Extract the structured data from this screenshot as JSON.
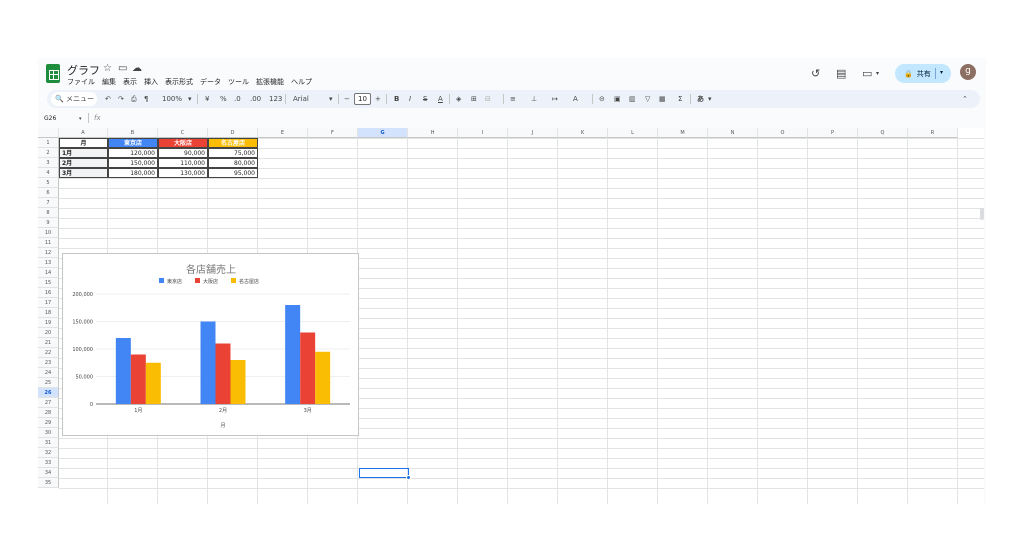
{
  "document": {
    "title": "グラフ"
  },
  "menu": [
    "ファイル",
    "編集",
    "表示",
    "挿入",
    "表示形式",
    "データ",
    "ツール",
    "拡張機能",
    "ヘルプ"
  ],
  "share": {
    "label": "共有"
  },
  "avatar": {
    "initial": "g"
  },
  "toolbar": {
    "search_label": "メニュー",
    "zoom": "100%",
    "currency": "¥",
    "percent": "%",
    "dec_decrease": ".0",
    "dec_increase": ".00",
    "format_123": "123",
    "font": "Arial",
    "font_size": "10",
    "bold": "B",
    "italic": "I",
    "strike": "S",
    "text_color": "A",
    "sum": "Σ",
    "input_tools": "あ"
  },
  "formula_bar": {
    "name_box": "G26",
    "fx": "fx"
  },
  "grid": {
    "columns": [
      "A",
      "B",
      "C",
      "D",
      "E",
      "F",
      "G",
      "H",
      "I",
      "J",
      "K",
      "L",
      "M",
      "N",
      "O",
      "P",
      "Q",
      "R"
    ],
    "rows": [
      "1",
      "2",
      "3",
      "4",
      "5",
      "6",
      "7",
      "8",
      "9",
      "10",
      "11",
      "12",
      "13",
      "14",
      "15",
      "16",
      "17",
      "18",
      "19",
      "20",
      "21",
      "22",
      "23",
      "24",
      "25",
      "26",
      "27",
      "28",
      "29",
      "30",
      "31",
      "32",
      "33",
      "34",
      "35"
    ],
    "selected_column": "G",
    "selected_row": "26"
  },
  "table": {
    "headers": [
      "月",
      "東京店",
      "大阪店",
      "名古屋店"
    ],
    "header_colors": [
      "#ffffff",
      "#4285f4",
      "#ea4335",
      "#fbbc04"
    ],
    "rows": [
      [
        "1月",
        "120,000",
        "90,000",
        "75,000"
      ],
      [
        "2月",
        "150,000",
        "110,000",
        "80,000"
      ],
      [
        "3月",
        "180,000",
        "130,000",
        "95,000"
      ]
    ]
  },
  "chart_data": {
    "type": "bar",
    "title": "各店舗売上",
    "xlabel": "月",
    "ylabel": "",
    "categories": [
      "1月",
      "2月",
      "3月"
    ],
    "series": [
      {
        "name": "東京店",
        "values": [
          120000,
          150000,
          180000
        ],
        "color": "#4285f4"
      },
      {
        "name": "大阪店",
        "values": [
          90000,
          110000,
          130000
        ],
        "color": "#ea4335"
      },
      {
        "name": "名古屋店",
        "values": [
          75000,
          80000,
          95000
        ],
        "color": "#fbbc04"
      }
    ],
    "ylim": [
      0,
      200000
    ],
    "yticks": [
      "0",
      "50,000",
      "100,000",
      "150,000",
      "200,000"
    ],
    "legend": "top",
    "grid": true
  }
}
